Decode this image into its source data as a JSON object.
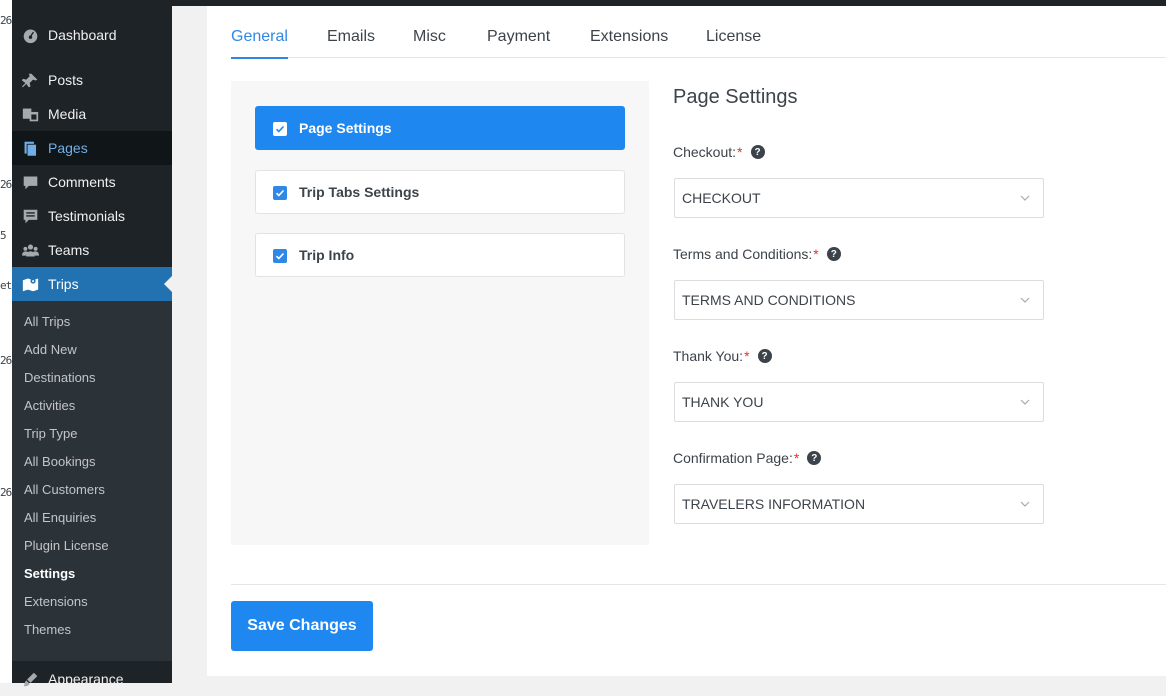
{
  "edge_fragments": [
    "26",
    "26",
    "5",
    "et",
    "26",
    "26"
  ],
  "sidebar": {
    "menu": [
      {
        "label": "Dashboard",
        "icon": "dashboard-icon"
      },
      {
        "label": "Posts",
        "icon": "pin-icon"
      },
      {
        "label": "Media",
        "icon": "media-icon"
      },
      {
        "label": "Pages",
        "icon": "pages-icon"
      },
      {
        "label": "Comments",
        "icon": "comment-icon"
      },
      {
        "label": "Testimonials",
        "icon": "testimonial-icon"
      },
      {
        "label": "Teams",
        "icon": "groups-icon"
      },
      {
        "label": "Trips",
        "icon": "map-icon"
      }
    ],
    "submenu": [
      "All Trips",
      "Add New",
      "Destinations",
      "Activities",
      "Trip Type",
      "All Bookings",
      "All Customers",
      "All Enquiries",
      "Plugin License",
      "Settings",
      "Extensions",
      "Themes"
    ],
    "appearance": "Appearance"
  },
  "tabs": [
    "General",
    "Emails",
    "Misc",
    "Payment",
    "Extensions",
    "License"
  ],
  "nav_cards": [
    "Page Settings",
    "Trip Tabs Settings",
    "Trip Info"
  ],
  "settings": {
    "title": "Page Settings",
    "fields": [
      {
        "label": "Checkout:",
        "required": "*",
        "value": "CHECKOUT"
      },
      {
        "label": "Terms and Conditions:",
        "required": "*",
        "value": "TERMS AND CONDITIONS"
      },
      {
        "label": "Thank You:",
        "required": "*",
        "value": "THANK YOU"
      },
      {
        "label": "Confirmation Page:",
        "required": "*",
        "value": "TRAVELERS INFORMATION"
      }
    ]
  },
  "save_label": "Save Changes",
  "colors": {
    "accent": "#1e88f0",
    "admin_dark": "#1d2327",
    "admin_blue": "#2271b1"
  }
}
